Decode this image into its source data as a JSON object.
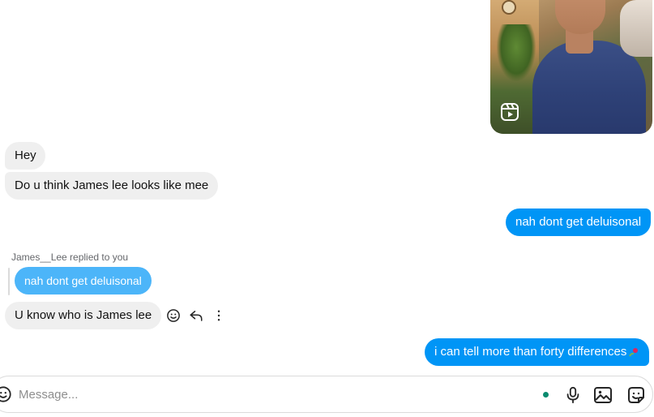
{
  "messages": {
    "incoming_1": "Hey",
    "incoming_2": "Do u think James lee looks like mee",
    "outgoing_1": "nah dont get deluisonal",
    "reply_label": "James__Lee replied to you",
    "quoted_text": "nah dont get deluisonal",
    "incoming_3": "U know who is James lee",
    "outgoing_2": "i can tell more than forty differences"
  },
  "composer": {
    "placeholder": "Message..."
  },
  "icons": {
    "reel": "reels-play-icon",
    "react": "smiley-icon",
    "reply": "reply-arrow-icon",
    "more": "more-vertical-icon",
    "emoji": "emoji-icon",
    "mic": "microphone-icon",
    "image": "image-icon",
    "sticker": "sticker-icon"
  },
  "colors": {
    "outgoing_bubble": "#0095f6",
    "quoted_bubble": "#4cb5f9",
    "incoming_bubble": "#efefef",
    "online_dot": "#0a8b6f"
  }
}
